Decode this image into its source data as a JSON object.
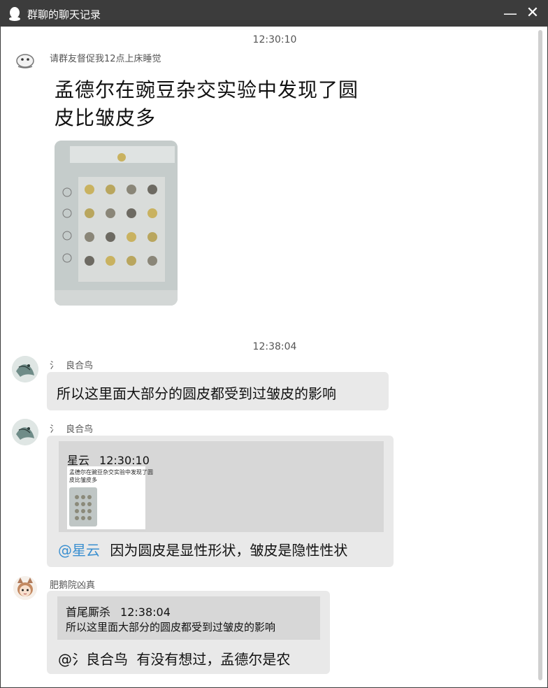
{
  "window": {
    "title": "群聊的聊天记录",
    "minimize_glyph": "—",
    "close_glyph": "✕"
  },
  "messages": [
    {
      "time": "12:30:10",
      "sender": "请群友督促我12点上床睡觉",
      "caption_line1": "孟德尔在豌豆杂交实验中发现了圆",
      "caption_line2": "皮比皱皮多",
      "image_icon": "pea-punnett-square-photo"
    },
    {
      "time": "12:38:04",
      "sender": "良合鸟",
      "prefix": "氵",
      "text": "所以这里面大部分的圆皮都受到过皱皮的影响"
    },
    {
      "sender": "良合鸟",
      "prefix": "氵",
      "quote_sender": "星云",
      "quote_time": "12:30:10",
      "quote_thumb_line1": "孟德尔在豌豆杂交实验中发现了圆",
      "quote_thumb_line2": "皮比皱皮多",
      "mention": "@星云",
      "text": "因为圆皮是显性形状，皱皮是隐性性状"
    },
    {
      "sender": "肥鹅院凶真",
      "quote_sender": "首尾厮杀",
      "quote_time": "12:38:04",
      "quote_text": "所以这里面大部分的圆皮都受到过皱皮的影响",
      "mention": "@氵良合鸟",
      "text": "有没有想过，孟德尔是农"
    }
  ]
}
